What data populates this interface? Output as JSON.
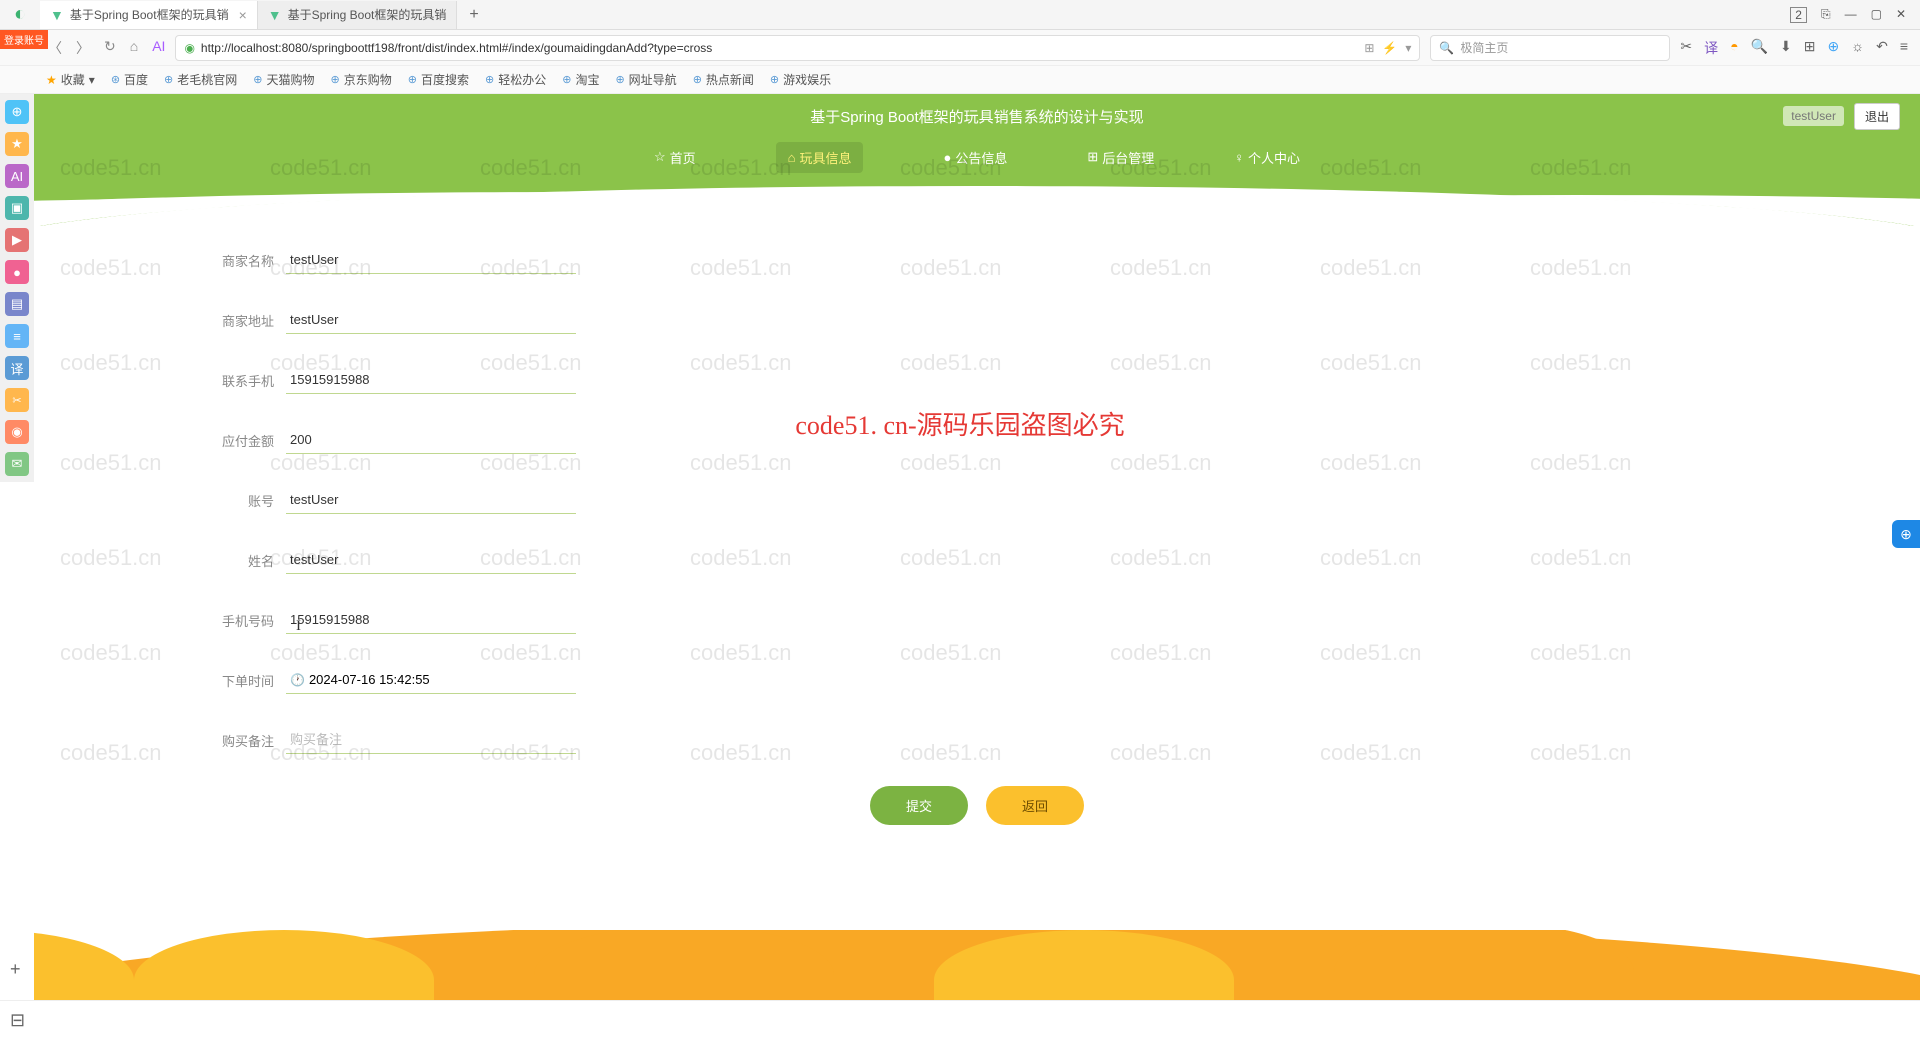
{
  "browser": {
    "tabs": [
      {
        "title": "基于Spring Boot框架的玩具销"
      },
      {
        "title": "基于Spring Boot框架的玩具销"
      }
    ],
    "url": "http://localhost:8080/springboottf198/front/dist/index.html#/index/goumaidingdanAdd?type=cross",
    "search_placeholder": "极简主页",
    "window_badge": "2"
  },
  "bookmarks_bar": {
    "fav_label": "收藏",
    "items": [
      "百度",
      "老毛桃官网",
      "天猫购物",
      "京东购物",
      "百度搜索",
      "轻松办公",
      "淘宝",
      "网址导航",
      "热点新闻",
      "游戏娱乐"
    ]
  },
  "login_badge": "登录账号",
  "header": {
    "title": "基于Spring Boot框架的玩具销售系统的设计与实现",
    "username": "testUser",
    "logout": "退出",
    "nav": [
      {
        "icon": "☆",
        "label": "首页"
      },
      {
        "icon": "⌂",
        "label": "玩具信息"
      },
      {
        "icon": "●",
        "label": "公告信息"
      },
      {
        "icon": "⊞",
        "label": "后台管理"
      },
      {
        "icon": "♀",
        "label": "个人中心"
      }
    ]
  },
  "form": {
    "rows": [
      {
        "label": "商家名称",
        "value": "testUser"
      },
      {
        "label": "商家地址",
        "value": "testUser"
      },
      {
        "label": "联系手机",
        "value": "15915915988"
      },
      {
        "label": "应付金额",
        "value": "200"
      },
      {
        "label": "账号",
        "value": "testUser"
      },
      {
        "label": "姓名",
        "value": "testUser"
      },
      {
        "label": "手机号码",
        "value": "15915915988"
      },
      {
        "label": "下单时间",
        "value": "2024-07-16 15:42:55",
        "has_clock": true
      },
      {
        "label": "购买备注",
        "value": "",
        "placeholder": "购买备注"
      }
    ],
    "submit": "提交",
    "return": "返回"
  },
  "watermark_text": "code51.cn",
  "center_overlay": "code51. cn-源码乐园盗图必究"
}
